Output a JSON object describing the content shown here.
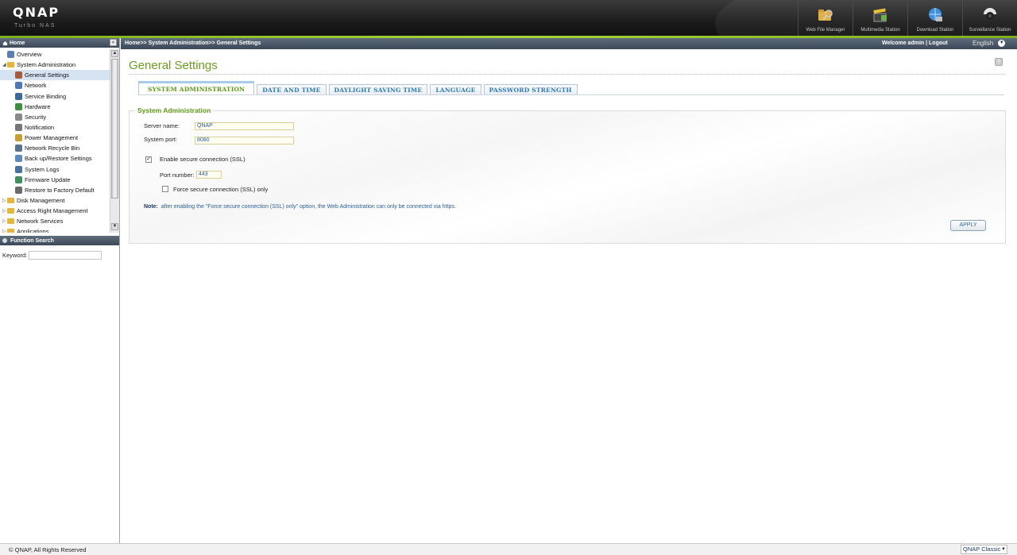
{
  "header": {
    "logo": "QNAP",
    "logo_sub": "Turbo NAS",
    "apps": [
      {
        "label": "Web File Manager",
        "icon": "folder-search-icon"
      },
      {
        "label": "Multimedia Station",
        "icon": "film-clapper-icon"
      },
      {
        "label": "Download Station",
        "icon": "globe-download-icon"
      },
      {
        "label": "Surveillance Station",
        "icon": "camera-icon"
      }
    ]
  },
  "sidebar": {
    "title": "Home",
    "tree": [
      {
        "label": "Overview",
        "level": 0,
        "icon": "overview-icon"
      },
      {
        "label": "System Administration",
        "level": 0,
        "icon": "folder-open-icon",
        "expanded": true
      },
      {
        "label": "General Settings",
        "level": 1,
        "icon": "settings-icon",
        "selected": true
      },
      {
        "label": "Network",
        "level": 1,
        "icon": "network-icon"
      },
      {
        "label": "Service Binding",
        "level": 1,
        "icon": "service-binding-icon"
      },
      {
        "label": "Hardware",
        "level": 1,
        "icon": "hardware-icon"
      },
      {
        "label": "Security",
        "level": 1,
        "icon": "security-icon"
      },
      {
        "label": "Notification",
        "level": 1,
        "icon": "notification-icon"
      },
      {
        "label": "Power Management",
        "level": 1,
        "icon": "power-icon"
      },
      {
        "label": "Network Recycle Bin",
        "level": 1,
        "icon": "recycle-bin-icon"
      },
      {
        "label": "Back up/Restore Settings",
        "level": 1,
        "icon": "backup-icon"
      },
      {
        "label": "System Logs",
        "level": 1,
        "icon": "logs-icon"
      },
      {
        "label": "Firmware Update",
        "level": 1,
        "icon": "firmware-icon"
      },
      {
        "label": "Restore to Factory Default",
        "level": 1,
        "icon": "factory-reset-icon"
      },
      {
        "label": "Disk Management",
        "level": 0,
        "icon": "folder-icon"
      },
      {
        "label": "Access Right Management",
        "level": 0,
        "icon": "folder-icon"
      },
      {
        "label": "Network Services",
        "level": 0,
        "icon": "folder-icon"
      },
      {
        "label": "Applications",
        "level": 0,
        "icon": "folder-icon"
      }
    ],
    "function_search": {
      "title": "Function Search",
      "keyword_label": "Keyword:",
      "keyword_value": ""
    }
  },
  "topbar": {
    "breadcrumb": "Home>> System Administration>> General Settings",
    "welcome": "Welcome admin | Logout",
    "language": "English"
  },
  "main": {
    "title": "General Settings",
    "tabs": [
      "SYSTEM ADMINISTRATION",
      "DATE AND TIME",
      "DAYLIGHT SAVING TIME",
      "LANGUAGE",
      "PASSWORD STRENGTH"
    ],
    "active_tab": "SYSTEM ADMINISTRATION",
    "section_title": "System Administration",
    "server_name_label": "Server name:",
    "server_name_value": "QNAP",
    "system_port_label": "System port:",
    "system_port_value": "8080",
    "ssl_label": "Enable secure connection (SSL)",
    "ssl_checked": true,
    "port_number_label": "Port number:",
    "port_number_value": "443",
    "force_ssl_label": "Force secure connection (SSL) only",
    "force_ssl_checked": false,
    "note_label": "Note:",
    "note_text": "after enabling the \"Force secure connection (SSL) only\" option, the Web Administration can only be connected via https.",
    "apply_label": "APPLY"
  },
  "footer": {
    "copyright": "© QNAP, All Rights Reserved",
    "theme": "QNAP Classic"
  }
}
